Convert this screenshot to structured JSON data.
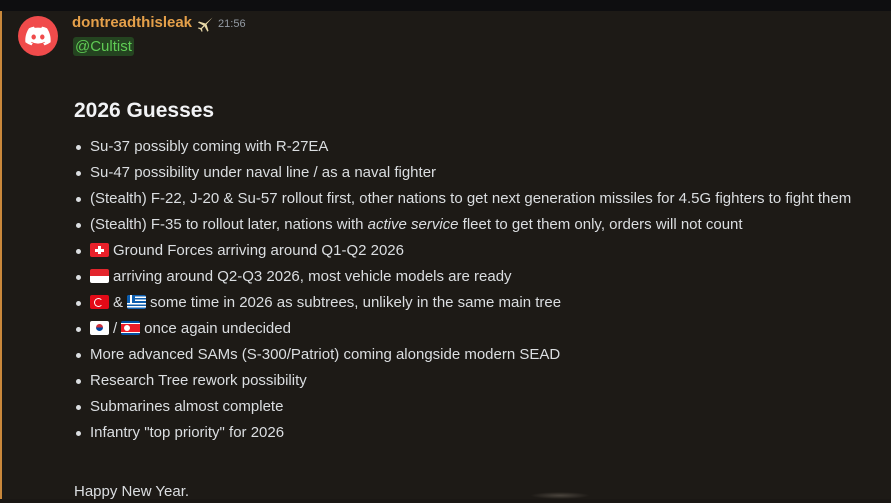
{
  "author": {
    "username": "dontreadthisleak",
    "timestamp": "21:56",
    "avatar_icon": "discord-logo-icon",
    "avatar_color": "#f04b4b",
    "name_color": "#e5a04a"
  },
  "mention": "@Cultist",
  "heading": "2026 Guesses",
  "items": [
    {
      "text": "Su-37 possibly coming with R-27EA"
    },
    {
      "text": "Su-47 possibility under naval line / as a naval fighter"
    },
    {
      "text": "(Stealth) F-22, J-20 & Su-57 rollout first, other nations to get next generation missiles for 4.5G fighters to fight them"
    },
    {
      "pre": "(Stealth) F-35 to rollout later, nations with ",
      "em": "active service",
      "post": " fleet to get them only, orders will not count"
    },
    {
      "flag": "switzerland-flag-icon",
      "text": "Ground Forces arriving around Q1-Q2 2026"
    },
    {
      "flag": "singapore-flag-icon",
      "text": "arriving around Q2-Q3 2026, most vehicle models are ready"
    },
    {
      "flag1": "turkey-flag-icon",
      "sep": "&",
      "flag2": "greece-flag-icon",
      "text": "some time in 2026 as subtrees, unlikely in the same main tree"
    },
    {
      "flag1": "south-korea-flag-icon",
      "sep": "/",
      "flag2": "north-korea-flag-icon",
      "text": "once again undecided"
    },
    {
      "text": "More advanced SAMs (S-300/Patriot) coming alongside modern SEAD"
    },
    {
      "text": "Research Tree rework possibility"
    },
    {
      "text": "Submarines almost complete"
    },
    {
      "text": "Infantry \"top priority\" for 2026"
    }
  ],
  "closing": "Happy New Year."
}
